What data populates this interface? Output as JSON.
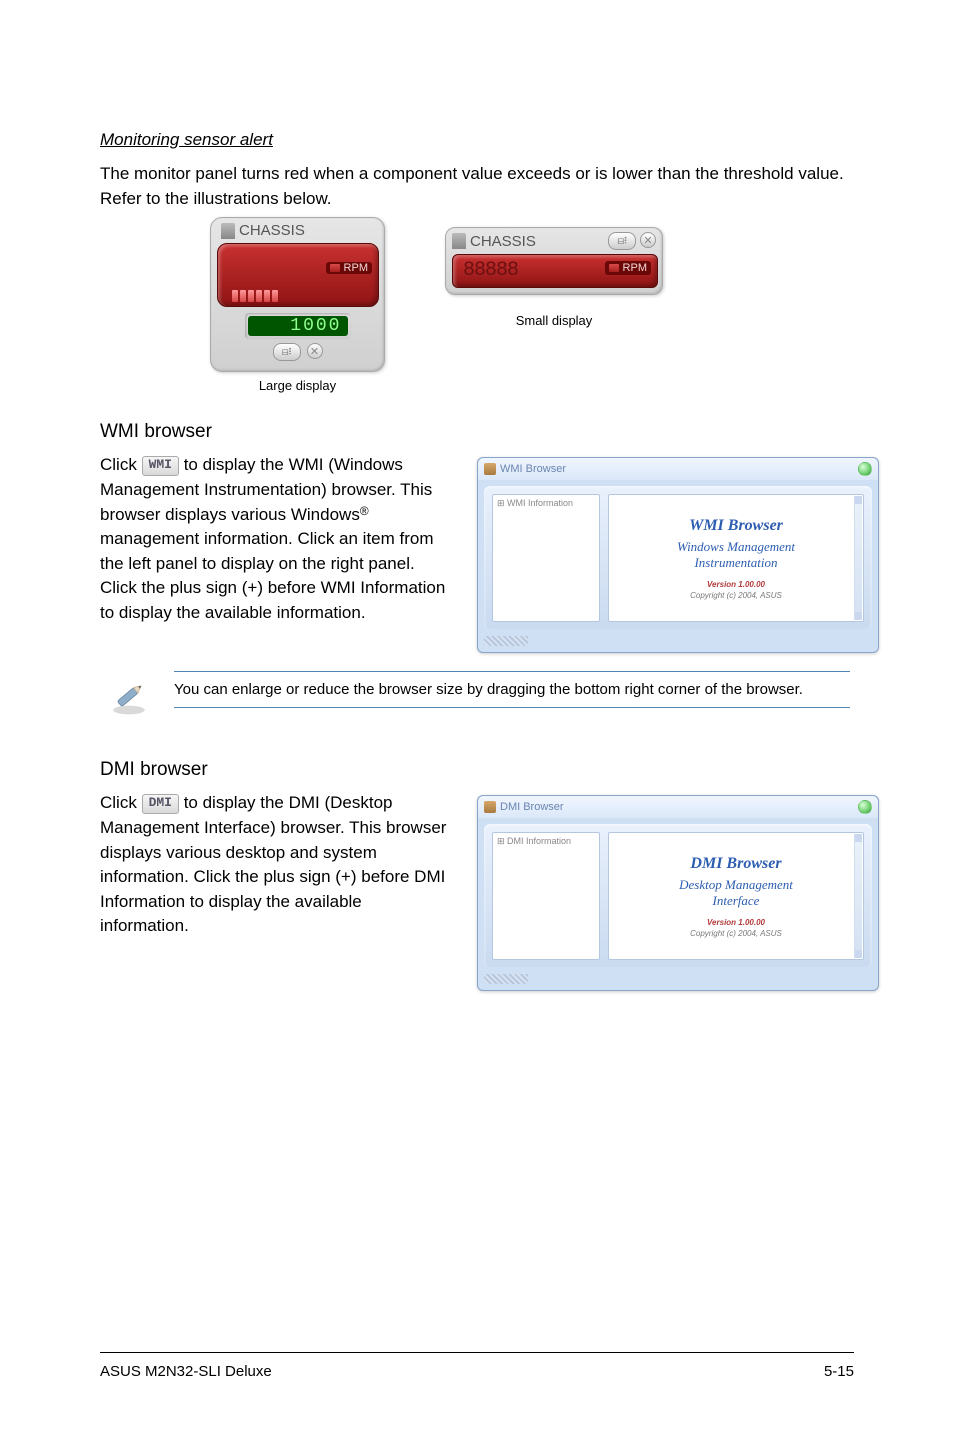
{
  "section1": {
    "heading": "Monitoring sensor alert",
    "body": "The monitor panel turns red when a component value exceeds or is lower than the threshold value. Refer to the illustrations below.",
    "large_caption": "Large display",
    "small_caption": "Small display",
    "chassis_label": "CHASSIS",
    "rpm_label": "RPM",
    "readout": "1000",
    "small_digits": "88888"
  },
  "wmi": {
    "heading": "WMI browser",
    "t1": "Click ",
    "btn": "WMI",
    "t2": " to display the WMI (Windows Management Instrumentation) browser. This browser displays various Windows",
    "t3": " management information. Click an item from the left panel to display on the right panel. Click the plus sign (+) before WMI Information to display the available information.",
    "win_title": "WMI Browser",
    "tree_root": "WMI Information",
    "pane_title": "WMI Browser",
    "pane_sub1": "Windows Management",
    "pane_sub2": "Instrumentation",
    "version": "Version 1.00.00",
    "copyright": "Copyright (c) 2004, ASUS"
  },
  "note": "You can enlarge or reduce the browser size by dragging the bottom right corner of the browser.",
  "dmi": {
    "heading": "DMI browser",
    "t1": "Click ",
    "btn": "DMI",
    "t2": " to display the DMI (Desktop Management Interface) browser. This browser displays various desktop and system information. Click the plus sign (+) before DMI Information to display the available information.",
    "win_title": "DMI Browser",
    "tree_root": "DMI Information",
    "pane_title": "DMI Browser",
    "pane_sub1": "Desktop Management",
    "pane_sub2": "Interface",
    "version": "Version 1.00.00",
    "copyright": "Copyright (c) 2004, ASUS"
  },
  "footer": {
    "left": "ASUS M2N32-SLI Deluxe",
    "right": "5-15"
  }
}
